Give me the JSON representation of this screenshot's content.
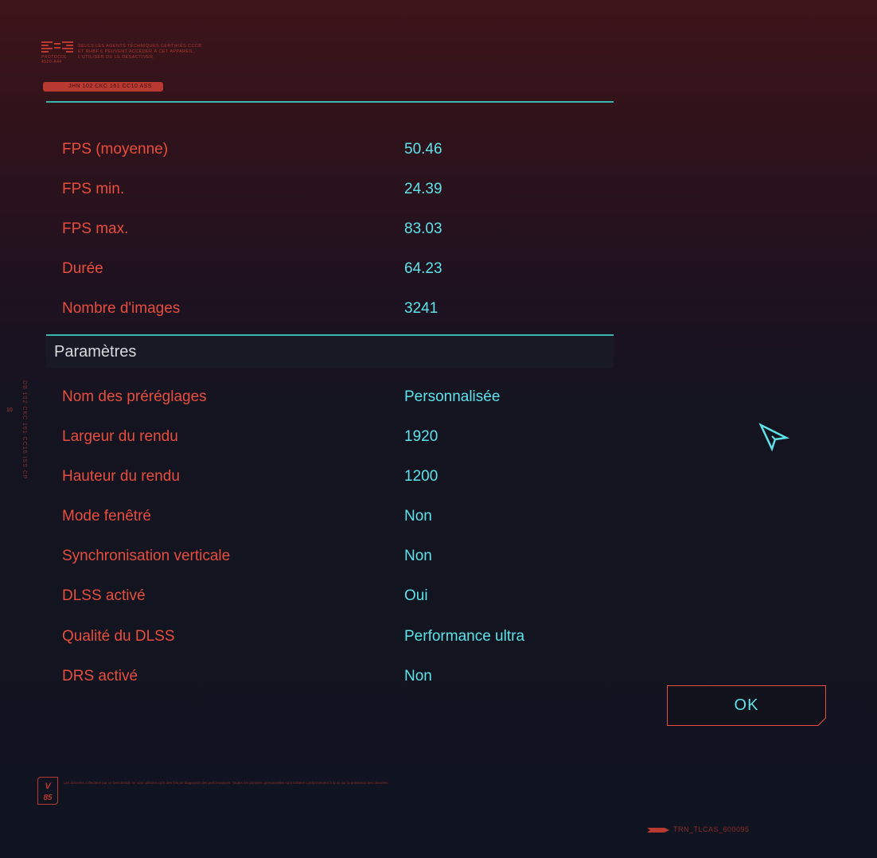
{
  "header": {
    "protocol_label": "PROTOCOL 4520-A44",
    "warning_text": "SEULS LES AGENTS TECHNIQUES CERTIFIÉS CCCB ET RHBF 6 PEUVENT ACCÉDER À CET APPAREIL, L'UTILISER OU LE DÉSACTIVER.",
    "tag_code": "JHN 102 CKC 161 CC10 ASS"
  },
  "results": [
    {
      "label": "FPS (moyenne)",
      "value": "50.46"
    },
    {
      "label": "FPS min.",
      "value": "24.39"
    },
    {
      "label": "FPS max.",
      "value": "83.03"
    },
    {
      "label": "Durée",
      "value": "64.23"
    },
    {
      "label": "Nombre d'images",
      "value": "3241"
    }
  ],
  "settings": {
    "title": "Paramètres",
    "items": [
      {
        "label": "Nom des préréglages",
        "value": "Personnalisée"
      },
      {
        "label": "Largeur du rendu",
        "value": "1920"
      },
      {
        "label": "Hauteur du rendu",
        "value": "1200"
      },
      {
        "label": "Mode fenêtré",
        "value": "Non"
      },
      {
        "label": "Synchronisation verticale",
        "value": "Non"
      },
      {
        "label": "DLSS activé",
        "value": "Oui"
      },
      {
        "label": "Qualité du DLSS",
        "value": "Performance ultra"
      },
      {
        "label": "DRS activé",
        "value": "Non"
      }
    ]
  },
  "side": {
    "vertical_code": "DB 102 CKC 161 CC10 ISS CP",
    "mark": "10"
  },
  "ok_button": {
    "label": "OK"
  },
  "footer": {
    "badge_text": "V 85",
    "fine_print": "Les données collectées par ce benchmark ne sont utilisées qu'à des fins de diagnostic des performances. Toutes les données personnelles sont traitées conformément à la loi sur la protection des données.",
    "bottom_code": "TRN_TLCAS_600095"
  },
  "colors": {
    "label_red": "#e84d3e",
    "value_cyan": "#5ee3ea",
    "rule_teal": "#38b6b0",
    "header_white": "#d9d9dc"
  },
  "icons": {
    "cursor": "cursor-arrow-icon",
    "logo": "protocol-logo-icon",
    "badge": "v85-badge-icon"
  }
}
